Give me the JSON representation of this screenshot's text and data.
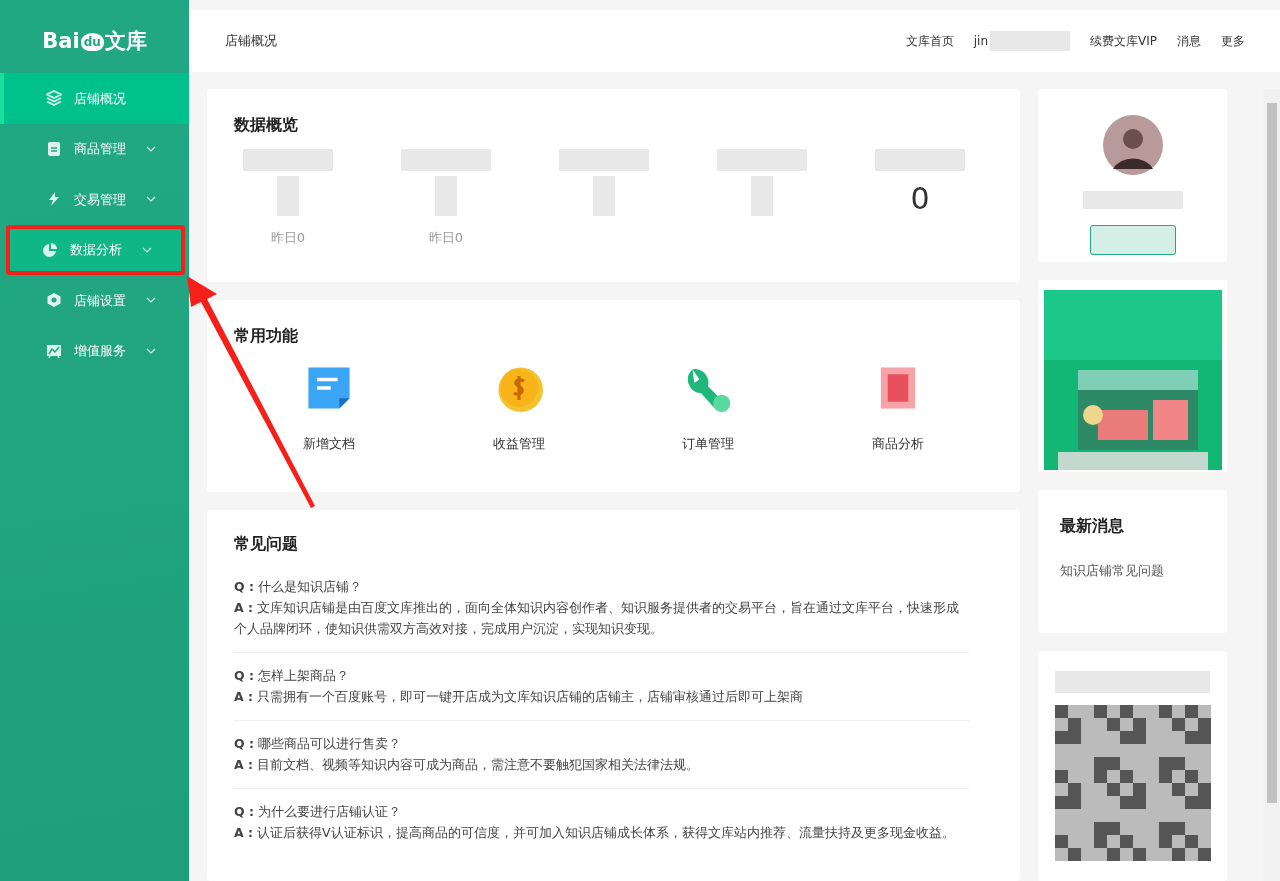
{
  "logo": {
    "text": "Bai",
    "badge": "du",
    "suffix": "文库"
  },
  "sidebar": {
    "items": [
      {
        "label": "店铺概况",
        "selected": true,
        "hovered": false,
        "expandable": false,
        "annotated": false
      },
      {
        "label": "商品管理",
        "selected": false,
        "hovered": false,
        "expandable": true,
        "annotated": false
      },
      {
        "label": "交易管理",
        "selected": false,
        "hovered": false,
        "expandable": true,
        "annotated": false
      },
      {
        "label": "数据分析",
        "selected": false,
        "hovered": true,
        "expandable": true,
        "annotated": true
      },
      {
        "label": "店铺设置",
        "selected": false,
        "hovered": false,
        "expandable": true,
        "annotated": false
      },
      {
        "label": "增值服务",
        "selected": false,
        "hovered": false,
        "expandable": true,
        "annotated": false
      }
    ]
  },
  "header": {
    "breadcrumb": "店铺概况",
    "links": [
      {
        "label": "文库首页",
        "kind": "link"
      },
      {
        "label": "jin",
        "kind": "user"
      },
      {
        "label": "续费文库VIP",
        "kind": "link"
      },
      {
        "label": "消息",
        "kind": "link"
      },
      {
        "label": "更多",
        "kind": "link"
      }
    ]
  },
  "overview": {
    "title": "数据概览",
    "stats": [
      {
        "label_masked": true,
        "value_masked": true,
        "sub": "昨日0"
      },
      {
        "label_masked": true,
        "value_masked": true,
        "sub": "昨日0"
      },
      {
        "label_masked": true,
        "value_masked": true
      },
      {
        "label_masked": true,
        "value_masked": true
      },
      {
        "label_masked": true,
        "value_masked": false,
        "value": "0"
      }
    ]
  },
  "functions": {
    "title": "常用功能",
    "items": [
      {
        "label": "新增文档"
      },
      {
        "label": "收益管理"
      },
      {
        "label": "订单管理"
      },
      {
        "label": "商品分析"
      }
    ]
  },
  "faq": {
    "title": "常见问题",
    "items": [
      {
        "q_mark": "Q :",
        "q": "什么是知识店铺？",
        "a_mark": "A :",
        "a": "文库知识店铺是由百度文库推出的，面向全体知识内容创作者、知识服务提供者的交易平台，旨在通过文库平台，快速形成个人品牌闭环，使知识供需双方高效对接，完成用户沉淀，实现知识变现。"
      },
      {
        "q_mark": "Q :",
        "q": "怎样上架商品？",
        "a_mark": "A :",
        "a": "只需拥有一个百度账号，即可一键开店成为文库知识店铺的店铺主，店铺审核通过后即可上架商"
      },
      {
        "q_mark": "Q :",
        "q": "哪些商品可以进行售卖？",
        "a_mark": "A :",
        "a": "目前文档、视频等知识内容可成为商品，需注意不要触犯国家相关法律法规。"
      },
      {
        "q_mark": "Q :",
        "q": "为什么要进行店铺认证？",
        "a_mark": "A :",
        "a": "认证后获得V认证标识，提高商品的可信度，并可加入知识店铺成长体系，获得文库站内推荐、流量扶持及更多现金收益。"
      }
    ]
  },
  "news": {
    "title": "最新消息",
    "items": [
      "知识店铺常见问题"
    ]
  }
}
